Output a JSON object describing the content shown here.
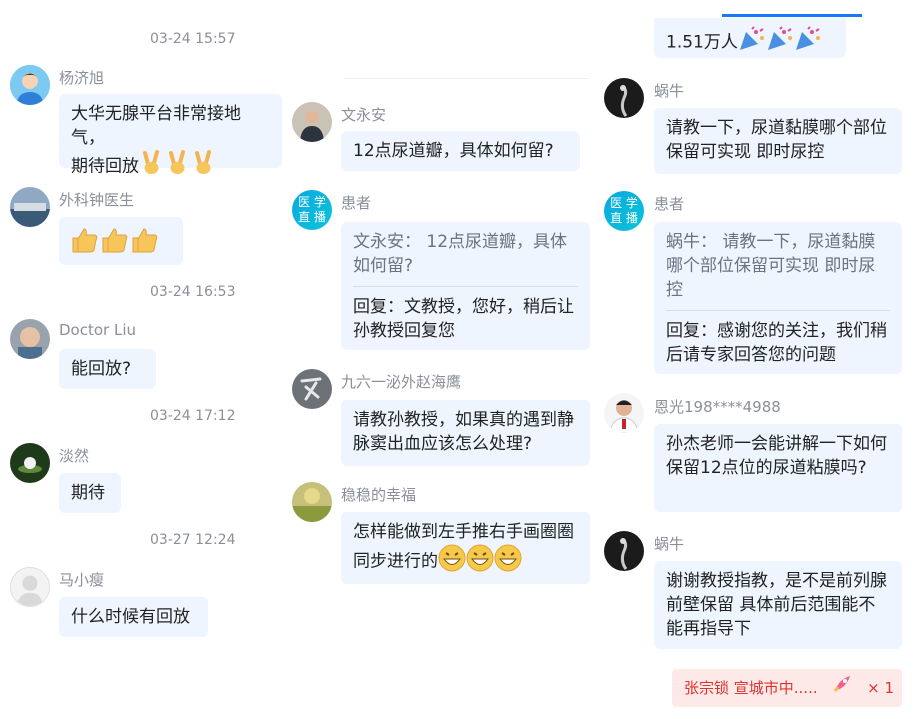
{
  "timestamps": [
    "03-24 15:57",
    "03-24 16:53",
    "03-24 17:12",
    "03-27 12:24"
  ],
  "left": [
    {
      "name": "杨济旭",
      "text": "大华无腺平台非常接地气，\n期待回放"
    },
    {
      "name": "外科钟医生",
      "text": ""
    },
    {
      "name": "Doctor Liu",
      "text": "能回放?"
    },
    {
      "name": "淡然",
      "text": "期待"
    },
    {
      "name": "马小瘦",
      "text": "什么时候有回放"
    }
  ],
  "middle": [
    {
      "name": "文永安",
      "text": "12点尿道瓣，具体如何留?"
    },
    {
      "name": "患者",
      "quote": "文永安： 12点尿道瓣，具体如何留?",
      "reply": "回复：文教授，您好，稍后让孙教授回复您"
    },
    {
      "name": "九六一泌外赵海鹰",
      "text": "请教孙教授，如果真的遇到静脉窦出血应该怎么处理?"
    },
    {
      "name": "稳稳的幸福",
      "text": "怎样能做到左手推右手画圈圈同步进行的"
    }
  ],
  "right": [
    {
      "top_text": "1.51万人"
    },
    {
      "name": "蜗牛",
      "text": "请教一下，尿道黏膜哪个部位保留可实现 即时尿控"
    },
    {
      "name": "患者",
      "quote": "蜗牛： 请教一下，尿道黏膜哪个部位保留可实现 即时尿控",
      "reply": "回复：感谢您的关注，我们稍后请专家回答您的问题"
    },
    {
      "name": "恩光198****4988",
      "text": "孙杰老师一会能讲解一下如何保留12点位的尿道粘膜吗?"
    },
    {
      "name": "蜗牛",
      "text": "谢谢教授指教，是不是前列腺前壁保留 具体前后范围能不能再指导下"
    }
  ],
  "avatar_labels": {
    "med_top": "医 学",
    "med_bottom": "直 播"
  },
  "gift": {
    "text": "张宗锁 宣城市中.....",
    "count": "× 1"
  },
  "colors": {
    "bubble": "#eef5ff",
    "accent": "#1677ff",
    "gift_bg": "#fde9e8",
    "gift_text": "#e0322e"
  }
}
